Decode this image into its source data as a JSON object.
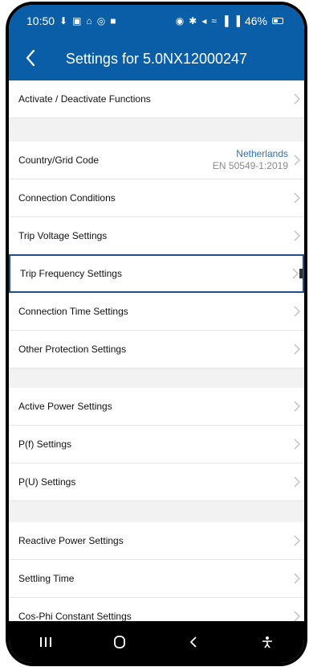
{
  "status_bar": {
    "time": "10:50",
    "battery": "46%",
    "left_icons": [
      "download-icon",
      "calendar-icon",
      "lock-icon",
      "shield-icon",
      "image-icon"
    ],
    "right_icons": [
      "alarm-icon",
      "bluetooth-icon",
      "mute-icon",
      "wifi-icon",
      "signal-icon",
      "signal-icon",
      "battery-icon"
    ]
  },
  "header": {
    "title": "Settings for 5.0NX12000247",
    "bg_color": "#0a5ea8"
  },
  "settings": {
    "activate": "Activate / Deactivate Functions",
    "country_label": "Country/Grid Code",
    "country_value": "Netherlands",
    "country_sub": "EN 50549-1:2019",
    "connection_conditions": "Connection Conditions",
    "trip_voltage": "Trip Voltage Settings",
    "trip_frequency": "Trip Frequency Settings",
    "connection_time": "Connection Time Settings",
    "other_protection": "Other Protection Settings",
    "active_power": "Active Power Settings",
    "pf": "P(f) Settings",
    "pu": "P(U) Settings",
    "reactive_power": "Reactive Power Settings",
    "settling_time": "Settling Time",
    "cos_phi": "Cos-Phi Constant Settings"
  },
  "colors": {
    "accent": "#0a5ea8",
    "value_blue": "#2b6fc0",
    "highlight_border": "#1f4f8f"
  }
}
